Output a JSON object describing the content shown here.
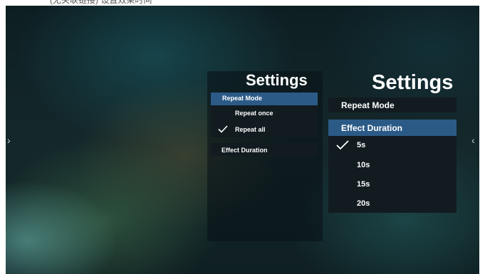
{
  "header_fragment": "(无关联链接) 设置效果时间",
  "icons": {
    "left": "chevron-right-icon",
    "right": "chevron-left-icon",
    "check": "check-icon"
  },
  "colors": {
    "selected_row": "#2b5a86",
    "row_bg": "#121b20",
    "panel_bg": "rgba(10,20,24,0.62)",
    "text": "#ffffff"
  },
  "left_panel": {
    "title": "Settings",
    "repeat_mode": {
      "label": "Repeat Mode",
      "options": [
        {
          "label": "Repeat once",
          "checked": false
        },
        {
          "label": "Repeat all",
          "checked": true
        }
      ]
    },
    "effect_duration": {
      "label": "Effect Duration"
    }
  },
  "right_panel": {
    "title": "Settings",
    "repeat_mode": {
      "label": "Repeat Mode"
    },
    "effect_duration": {
      "label": "Effect Duration",
      "options": [
        {
          "label": "5s",
          "checked": true
        },
        {
          "label": "10s",
          "checked": false
        },
        {
          "label": "15s",
          "checked": false
        },
        {
          "label": "20s",
          "checked": false
        }
      ]
    }
  }
}
